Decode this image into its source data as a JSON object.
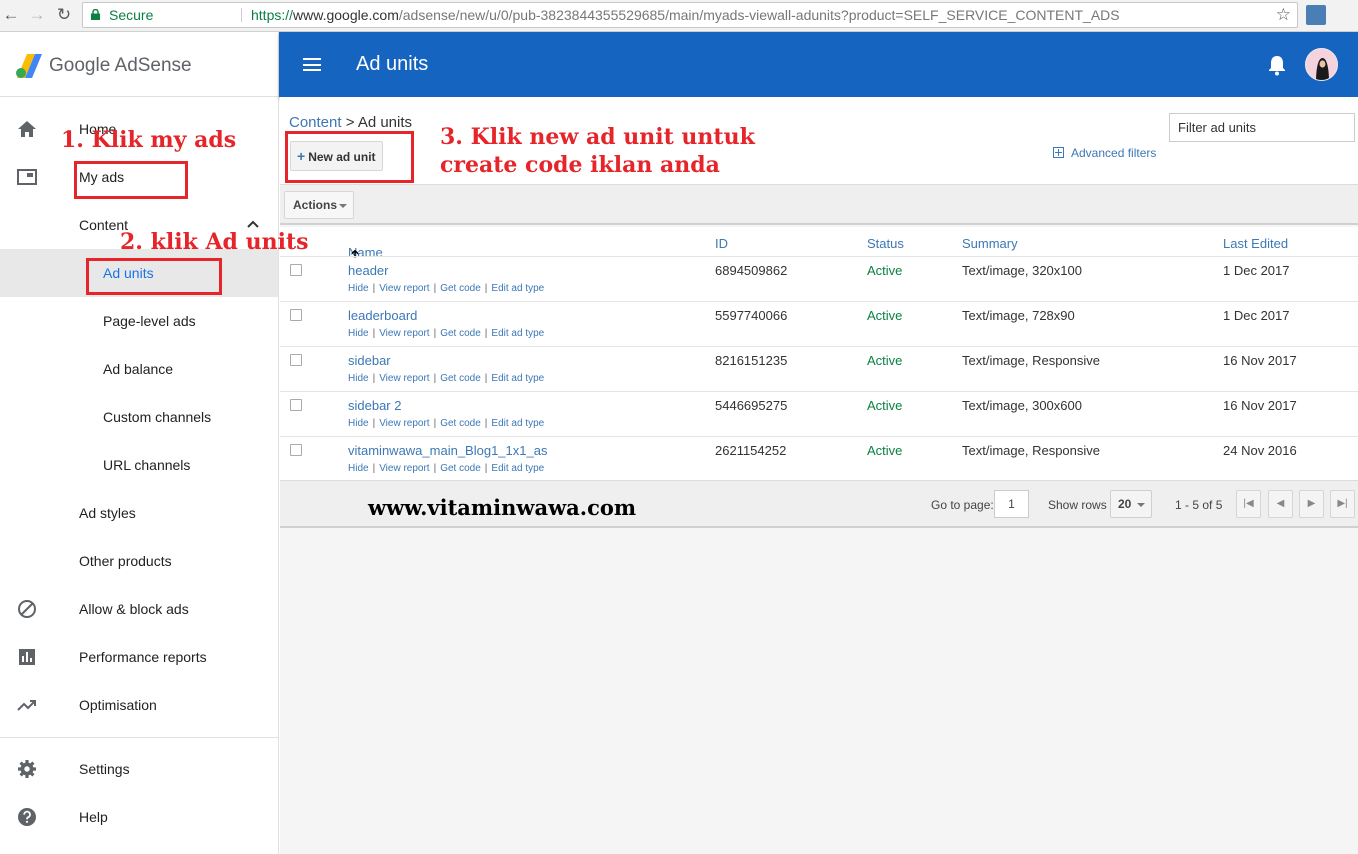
{
  "browser": {
    "secure_label": "Secure",
    "url_scheme": "https://",
    "url_host": "www.google.com",
    "url_path": "/adsense/new/u/0/pub-3823844355529685/main/myads-viewall-adunits?product=SELF_SERVICE_CONTENT_ADS"
  },
  "sidebar": {
    "logo_google": "Google",
    "logo_product": "AdSense",
    "items": {
      "home": "Home",
      "my_ads": "My ads",
      "content": "Content",
      "ad_units": "Ad units",
      "page_level_ads": "Page-level ads",
      "ad_balance": "Ad balance",
      "custom_channels": "Custom channels",
      "url_channels": "URL channels",
      "ad_styles": "Ad styles",
      "other_products": "Other products",
      "allow_block_ads": "Allow & block ads",
      "performance_reports": "Performance reports",
      "optimisation": "Optimisation",
      "settings": "Settings",
      "help": "Help"
    }
  },
  "header": {
    "title": "Ad units"
  },
  "breadcrumb": {
    "parent": "Content",
    "separator": " > ",
    "current": "Ad units"
  },
  "toolbar": {
    "new_ad_unit": "New ad unit",
    "filter_placeholder": "Filter ad units",
    "advanced_filters": "Advanced filters",
    "actions": "Actions"
  },
  "table": {
    "columns": {
      "name": "Name",
      "id": "ID",
      "status": "Status",
      "summary": "Summary",
      "last_edited": "Last Edited"
    },
    "row_links": {
      "hide": "Hide",
      "view_report": "View report",
      "get_code": "Get code",
      "edit_ad_type": "Edit ad type"
    },
    "rows": [
      {
        "name": "header",
        "id": "6894509862",
        "status": "Active",
        "summary": "Text/image, 320x100",
        "last_edited": "1 Dec 2017"
      },
      {
        "name": "leaderboard",
        "id": "5597740066",
        "status": "Active",
        "summary": "Text/image, 728x90",
        "last_edited": "1 Dec 2017"
      },
      {
        "name": "sidebar",
        "id": "8216151235",
        "status": "Active",
        "summary": "Text/image, Responsive",
        "last_edited": "16 Nov 2017"
      },
      {
        "name": "sidebar 2",
        "id": "5446695275",
        "status": "Active",
        "summary": "Text/image, 300x600",
        "last_edited": "16 Nov 2017"
      },
      {
        "name": "vitaminwawa_main_Blog1_1x1_as",
        "id": "2621154252",
        "status": "Active",
        "summary": "Text/image, Responsive",
        "last_edited": "24 Nov 2016"
      }
    ]
  },
  "pager": {
    "go_to_page_label": "Go to page:",
    "page_value": "1",
    "show_rows_label": "Show rows",
    "rows_value": "20",
    "range_text": "1 - 5 of 5"
  },
  "annotations": {
    "step1": "1. Klik my ads",
    "step2": "2. klik Ad units",
    "step3_line1": "3. Klik new ad unit untuk",
    "step3_line2": "create code iklan anda",
    "watermark": "www.vitaminwawa.com"
  },
  "colors": {
    "header_blue": "#1565c0",
    "link_blue": "#3c78b5",
    "status_green": "#0b8043",
    "annotation_red": "#e5252a"
  }
}
